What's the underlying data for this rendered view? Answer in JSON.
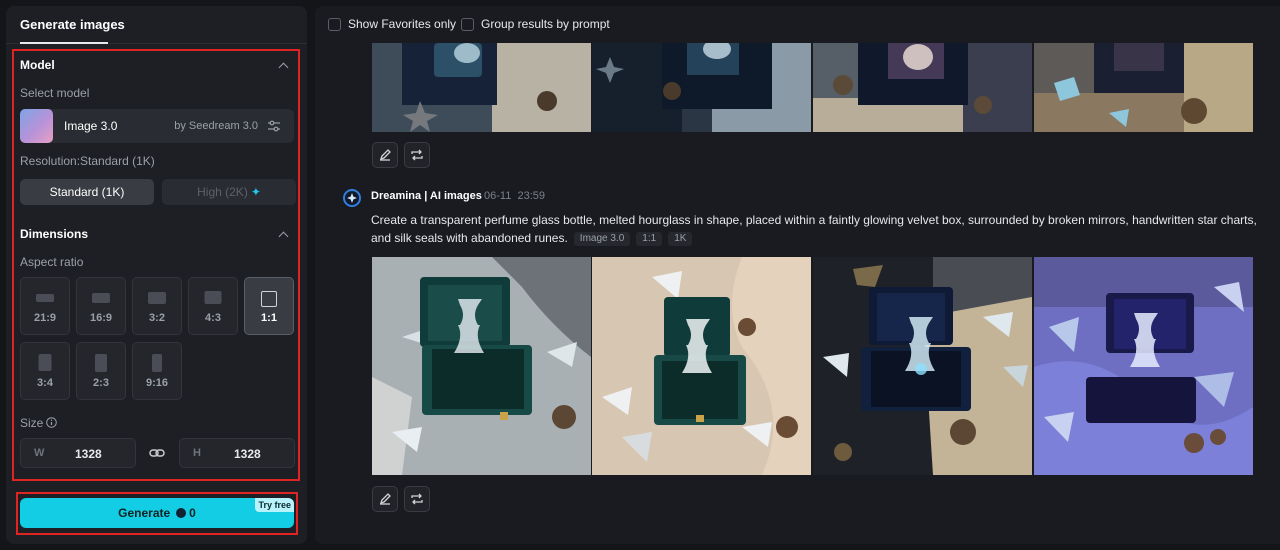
{
  "left_panel": {
    "tab_label": "Generate images",
    "model_section": {
      "title": "Model",
      "select_label": "Select model",
      "model_name": "Image 3.0",
      "model_by": "by Seedream 3.0",
      "resolution_label": "Resolution:Standard (1K)",
      "resolution_options": [
        "Standard (1K)",
        "High (2K)"
      ],
      "selected_resolution": "Standard (1K)"
    },
    "dimensions_section": {
      "title": "Dimensions",
      "aspect_label": "Aspect ratio",
      "aspect_ratios": [
        "21:9",
        "16:9",
        "3:2",
        "4:3",
        "1:1",
        "3:4",
        "2:3",
        "9:16"
      ],
      "selected_ratio": "1:1",
      "size_label": "Size",
      "width_key": "W",
      "width_value": "1328",
      "height_key": "H",
      "height_value": "1328"
    },
    "generate_label": "Generate",
    "generate_cost": "0",
    "try_free_label": "Try free"
  },
  "toolbar": {
    "show_favorites": "Show Favorites only",
    "group_results": "Group results by prompt"
  },
  "result": {
    "user": "Dreamina | AI images",
    "date": "06-11",
    "time": "23:59",
    "prompt": "Create a transparent perfume glass bottle, melted hourglass in shape, placed within a faintly glowing velvet box, surrounded by broken mirrors, handwritten star charts, and silk seals with abandoned runes.",
    "tags": [
      "Image 3.0",
      "1:1",
      "1K"
    ]
  },
  "colors": {
    "accent": "#12cde3",
    "highlight_box": "#e02424"
  }
}
